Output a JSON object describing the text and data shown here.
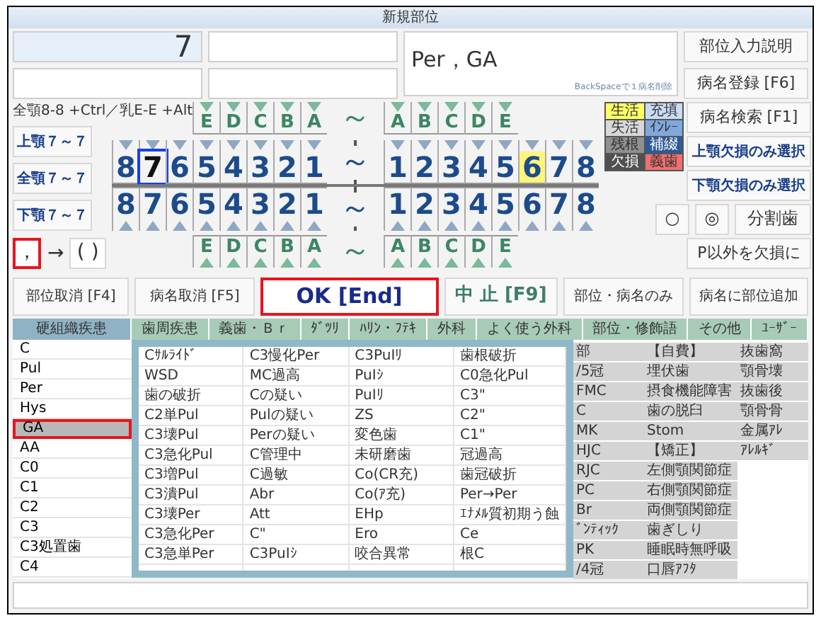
{
  "window": {
    "title": "新規部位"
  },
  "site_fields": [
    {
      "value": "7",
      "focused": true
    },
    {
      "focused": false
    },
    {
      "focused": false
    },
    {
      "focused": false
    }
  ],
  "diagnosis": {
    "value": "Per，GA",
    "hint": "BackSpaceで１病名削除"
  },
  "top_buttons": [
    "部位入力説明",
    "病名登録 [F6]"
  ],
  "shortcut_hint": "全顎8-8 +Ctrl／乳E-E +Alt",
  "jaw_buttons": [
    "上顎７～７",
    "全顎７～７",
    "下顎７～７"
  ],
  "separators": [
    {
      "label": "，",
      "selected": true
    },
    {
      "label": "( )",
      "selected": false
    }
  ],
  "arrow": "→",
  "chart": {
    "rows": [
      {
        "kind": "deciduous",
        "upper": true,
        "tilde": "～",
        "left": [
          {
            "label": "E",
            "selected": false,
            "highlighted": false
          },
          {
            "label": "D",
            "selected": false,
            "highlighted": false
          },
          {
            "label": "C",
            "selected": false,
            "highlighted": false
          },
          {
            "label": "B",
            "selected": false,
            "highlighted": false
          },
          {
            "label": "A",
            "selected": false,
            "highlighted": false
          }
        ],
        "right": [
          {
            "label": "A",
            "selected": false,
            "highlighted": false
          },
          {
            "label": "B",
            "selected": false,
            "highlighted": false
          },
          {
            "label": "C",
            "selected": false,
            "highlighted": false
          },
          {
            "label": "D",
            "selected": false,
            "highlighted": false
          },
          {
            "label": "E",
            "selected": false,
            "highlighted": false
          }
        ]
      },
      {
        "kind": "permanent",
        "upper": true,
        "tilde": "～",
        "left": [
          {
            "label": "8",
            "selected": false,
            "highlighted": false
          },
          {
            "label": "7",
            "selected": true,
            "highlighted": false
          },
          {
            "label": "6",
            "selected": false,
            "highlighted": false
          },
          {
            "label": "5",
            "selected": false,
            "highlighted": false
          },
          {
            "label": "4",
            "selected": false,
            "highlighted": false
          },
          {
            "label": "3",
            "selected": false,
            "highlighted": false
          },
          {
            "label": "2",
            "selected": false,
            "highlighted": false
          },
          {
            "label": "1",
            "selected": false,
            "highlighted": false
          }
        ],
        "right": [
          {
            "label": "1",
            "selected": false,
            "highlighted": false
          },
          {
            "label": "2",
            "selected": false,
            "highlighted": false
          },
          {
            "label": "3",
            "selected": false,
            "highlighted": false
          },
          {
            "label": "4",
            "selected": false,
            "highlighted": false
          },
          {
            "label": "5",
            "selected": false,
            "highlighted": false
          },
          {
            "label": "6",
            "selected": false,
            "highlighted": true
          },
          {
            "label": "7",
            "selected": false,
            "highlighted": false
          },
          {
            "label": "8",
            "selected": false,
            "highlighted": false
          }
        ]
      },
      {
        "kind": "permanent",
        "upper": false,
        "tilde": "～",
        "left": [
          {
            "label": "8",
            "selected": false,
            "highlighted": false
          },
          {
            "label": "7",
            "selected": false,
            "highlighted": false
          },
          {
            "label": "6",
            "selected": false,
            "highlighted": false
          },
          {
            "label": "5",
            "selected": false,
            "highlighted": false
          },
          {
            "label": "4",
            "selected": false,
            "highlighted": false
          },
          {
            "label": "3",
            "selected": false,
            "highlighted": false
          },
          {
            "label": "2",
            "selected": false,
            "highlighted": false
          },
          {
            "label": "1",
            "selected": false,
            "highlighted": false
          }
        ],
        "right": [
          {
            "label": "1",
            "selected": false,
            "highlighted": false
          },
          {
            "label": "2",
            "selected": false,
            "highlighted": false
          },
          {
            "label": "3",
            "selected": false,
            "highlighted": false
          },
          {
            "label": "4",
            "selected": false,
            "highlighted": false
          },
          {
            "label": "5",
            "selected": false,
            "highlighted": false
          },
          {
            "label": "6",
            "selected": false,
            "highlighted": false
          },
          {
            "label": "7",
            "selected": false,
            "highlighted": false
          },
          {
            "label": "8",
            "selected": false,
            "highlighted": false
          }
        ]
      },
      {
        "kind": "deciduous",
        "upper": false,
        "tilde": "～",
        "left": [
          {
            "label": "E",
            "selected": false,
            "highlighted": false
          },
          {
            "label": "D",
            "selected": false,
            "highlighted": false
          },
          {
            "label": "C",
            "selected": false,
            "highlighted": false
          },
          {
            "label": "B",
            "selected": false,
            "highlighted": false
          },
          {
            "label": "A",
            "selected": false,
            "highlighted": false
          }
        ],
        "right": [
          {
            "label": "A",
            "selected": false,
            "highlighted": false
          },
          {
            "label": "B",
            "selected": false,
            "highlighted": false
          },
          {
            "label": "C",
            "selected": false,
            "highlighted": false
          },
          {
            "label": "D",
            "selected": false,
            "highlighted": false
          },
          {
            "label": "E",
            "selected": false,
            "highlighted": false
          }
        ]
      }
    ]
  },
  "legend": [
    {
      "label": "生活",
      "color": "#ffff66"
    },
    {
      "label": "充填",
      "color": "#c8dcf5"
    },
    {
      "label": "失活",
      "color": "#d8d8d8"
    },
    {
      "label": "ｲﾝﾚｰ",
      "color": "#7fa8dc"
    },
    {
      "label": "残根",
      "color": "#909090"
    },
    {
      "label": "補綴",
      "color": "#2d5a9a"
    },
    {
      "label": "欠損",
      "color": "#505050"
    },
    {
      "label": "義歯",
      "color": "#f07070"
    }
  ],
  "side_buttons": [
    "病名検索 [F1]",
    "上顎欠損のみ選択",
    "下顎欠損のみ選択"
  ],
  "tooth_options": [
    "○",
    "◎",
    "分割歯"
  ],
  "missing_button": "P以外を欠損に",
  "actions": [
    {
      "label": "部位取消 [F4]",
      "kind": "plain",
      "focused": false
    },
    {
      "label": "病名取消 [F5]",
      "kind": "plain",
      "focused": false
    },
    {
      "label": "OK [End]",
      "kind": "ok",
      "focused": true
    },
    {
      "label": "中 止 [F9]",
      "kind": "cancel",
      "focused": false
    },
    {
      "label": "部位・病名のみ",
      "kind": "plain",
      "focused": false
    },
    {
      "label": "病名に部位追加",
      "kind": "plain",
      "focused": false
    }
  ],
  "tabs": [
    {
      "label": "硬組織疾患",
      "selected": true
    },
    {
      "label": "歯周疾患",
      "selected": false
    },
    {
      "label": "義歯・Ｂｒ",
      "selected": false
    },
    {
      "label": "ﾀﾞﾂﾘ",
      "selected": false
    },
    {
      "label": "ﾊﾘﾝ・ﾌﾃｷ",
      "selected": false
    },
    {
      "label": "外科",
      "selected": false
    },
    {
      "label": "よく使う外科",
      "selected": false
    },
    {
      "label": "部位・修飾語",
      "selected": false
    },
    {
      "label": "その他",
      "selected": false
    },
    {
      "label": "ﾕｰｻﾞｰ",
      "selected": false
    }
  ],
  "category_list": [
    {
      "label": "C",
      "selected": false
    },
    {
      "label": "Pul",
      "selected": false
    },
    {
      "label": "Per",
      "selected": false
    },
    {
      "label": "Hys",
      "selected": false
    },
    {
      "label": "GA",
      "selected": true
    },
    {
      "label": "AA",
      "selected": false
    },
    {
      "label": "C0",
      "selected": false
    },
    {
      "label": "C1",
      "selected": false
    },
    {
      "label": "C2",
      "selected": false
    },
    {
      "label": "C3",
      "selected": false
    },
    {
      "label": "C3処置歯",
      "selected": false
    },
    {
      "label": "C4",
      "selected": false
    }
  ],
  "popup": {
    "columns": [
      [
        "Cｻﾙﾗｲﾄﾞ",
        "WSD",
        "歯の破折",
        "C2単Pul",
        "C3壊Pul",
        "C3急化Pul",
        "C3増Pul",
        "C3潰Pul",
        "C3壊Per",
        "C3急化Per",
        "C3急単Per"
      ],
      [
        "C3慢化Per",
        "MC過高",
        "Cの疑い",
        "Pulの疑い",
        "Perの疑い",
        "C管理中",
        "C過敏",
        "Abr",
        "Att",
        "C\"",
        "C3PuIｼ"
      ],
      [
        "C3PuIﾘ",
        "PuIｼ",
        "PuIﾘ",
        "ZS",
        "変色歯",
        "未研磨歯",
        "Co(CR充)",
        "Co(ｱ充)",
        "EHp",
        "Ero",
        "咬合異常"
      ],
      [
        "歯根破折",
        "C0急化Pul",
        "C3\"",
        "C2\"",
        "C1\"",
        "冠過高",
        "歯冠破折",
        "Per→Per",
        "ｴﾅﾒﾙ質初期う蝕",
        "Ce",
        "根C"
      ]
    ]
  },
  "other_columns": [
    {
      "items": [
        "部",
        "/5冠",
        "FMC",
        "C",
        "MK",
        "HJC",
        "RJC",
        "PC",
        "Br",
        "ﾞﾝﾃｨｯｸ",
        "PK",
        "/4冠"
      ]
    },
    {
      "items": [
        "【自費】",
        "埋伏歯",
        "摂食機能障害",
        "歯の脱臼",
        "Stom",
        "【矯正】",
        "左側顎関節症",
        "右側顎関節症",
        "両側顎関節症",
        "歯ぎしり",
        "睡眠時無呼吸",
        "口唇ｱﾌﾀ"
      ]
    },
    {
      "items": [
        "抜歯窩",
        "顎骨壊",
        "抜歯後",
        "顎骨骨",
        "金属ｱﾚ",
        "ｱﾚﾙｷﾞ"
      ]
    }
  ]
}
